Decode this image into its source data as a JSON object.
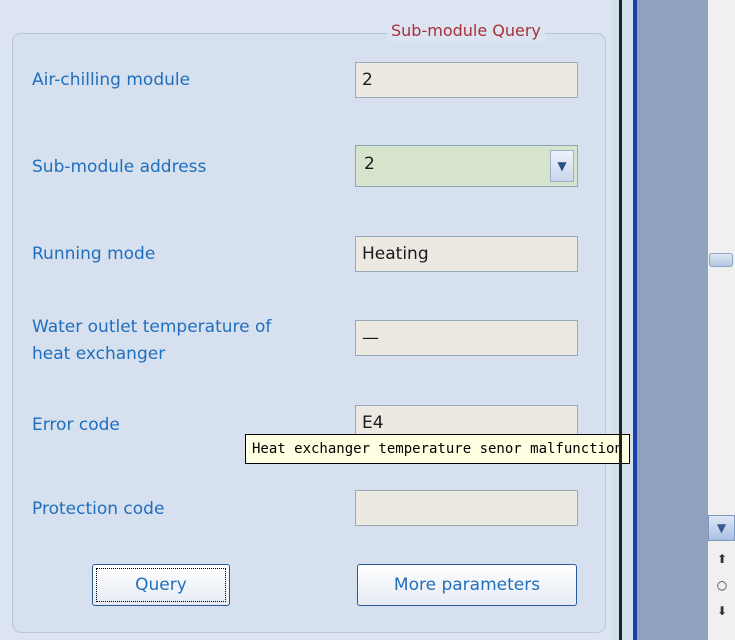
{
  "group": {
    "title": "Sub-module Query"
  },
  "fields": {
    "air_chilling_module": {
      "label": "Air-chilling module",
      "value": "2"
    },
    "sub_module_address": {
      "label": "Sub-module address",
      "value": "2"
    },
    "running_mode": {
      "label": "Running mode",
      "value": "Heating"
    },
    "water_outlet_temp": {
      "label_line1": "Water outlet temperature of",
      "label_line2": "heat exchanger",
      "value": "—"
    },
    "error_code": {
      "label": "Error code",
      "value": "E4"
    },
    "protection_code": {
      "label": "Protection code",
      "value": ""
    }
  },
  "tooltip": {
    "text": "Heat exchanger temperature senor malfunction"
  },
  "buttons": {
    "query": "Query",
    "more_parameters": "More parameters"
  },
  "icons": {
    "dropdown": "chevron-down-icon",
    "scroll_down": "chevron-down-icon",
    "nav_up": "arrow-up-icon",
    "nav_circle": "circle-icon",
    "nav_down": "arrow-down-icon"
  }
}
